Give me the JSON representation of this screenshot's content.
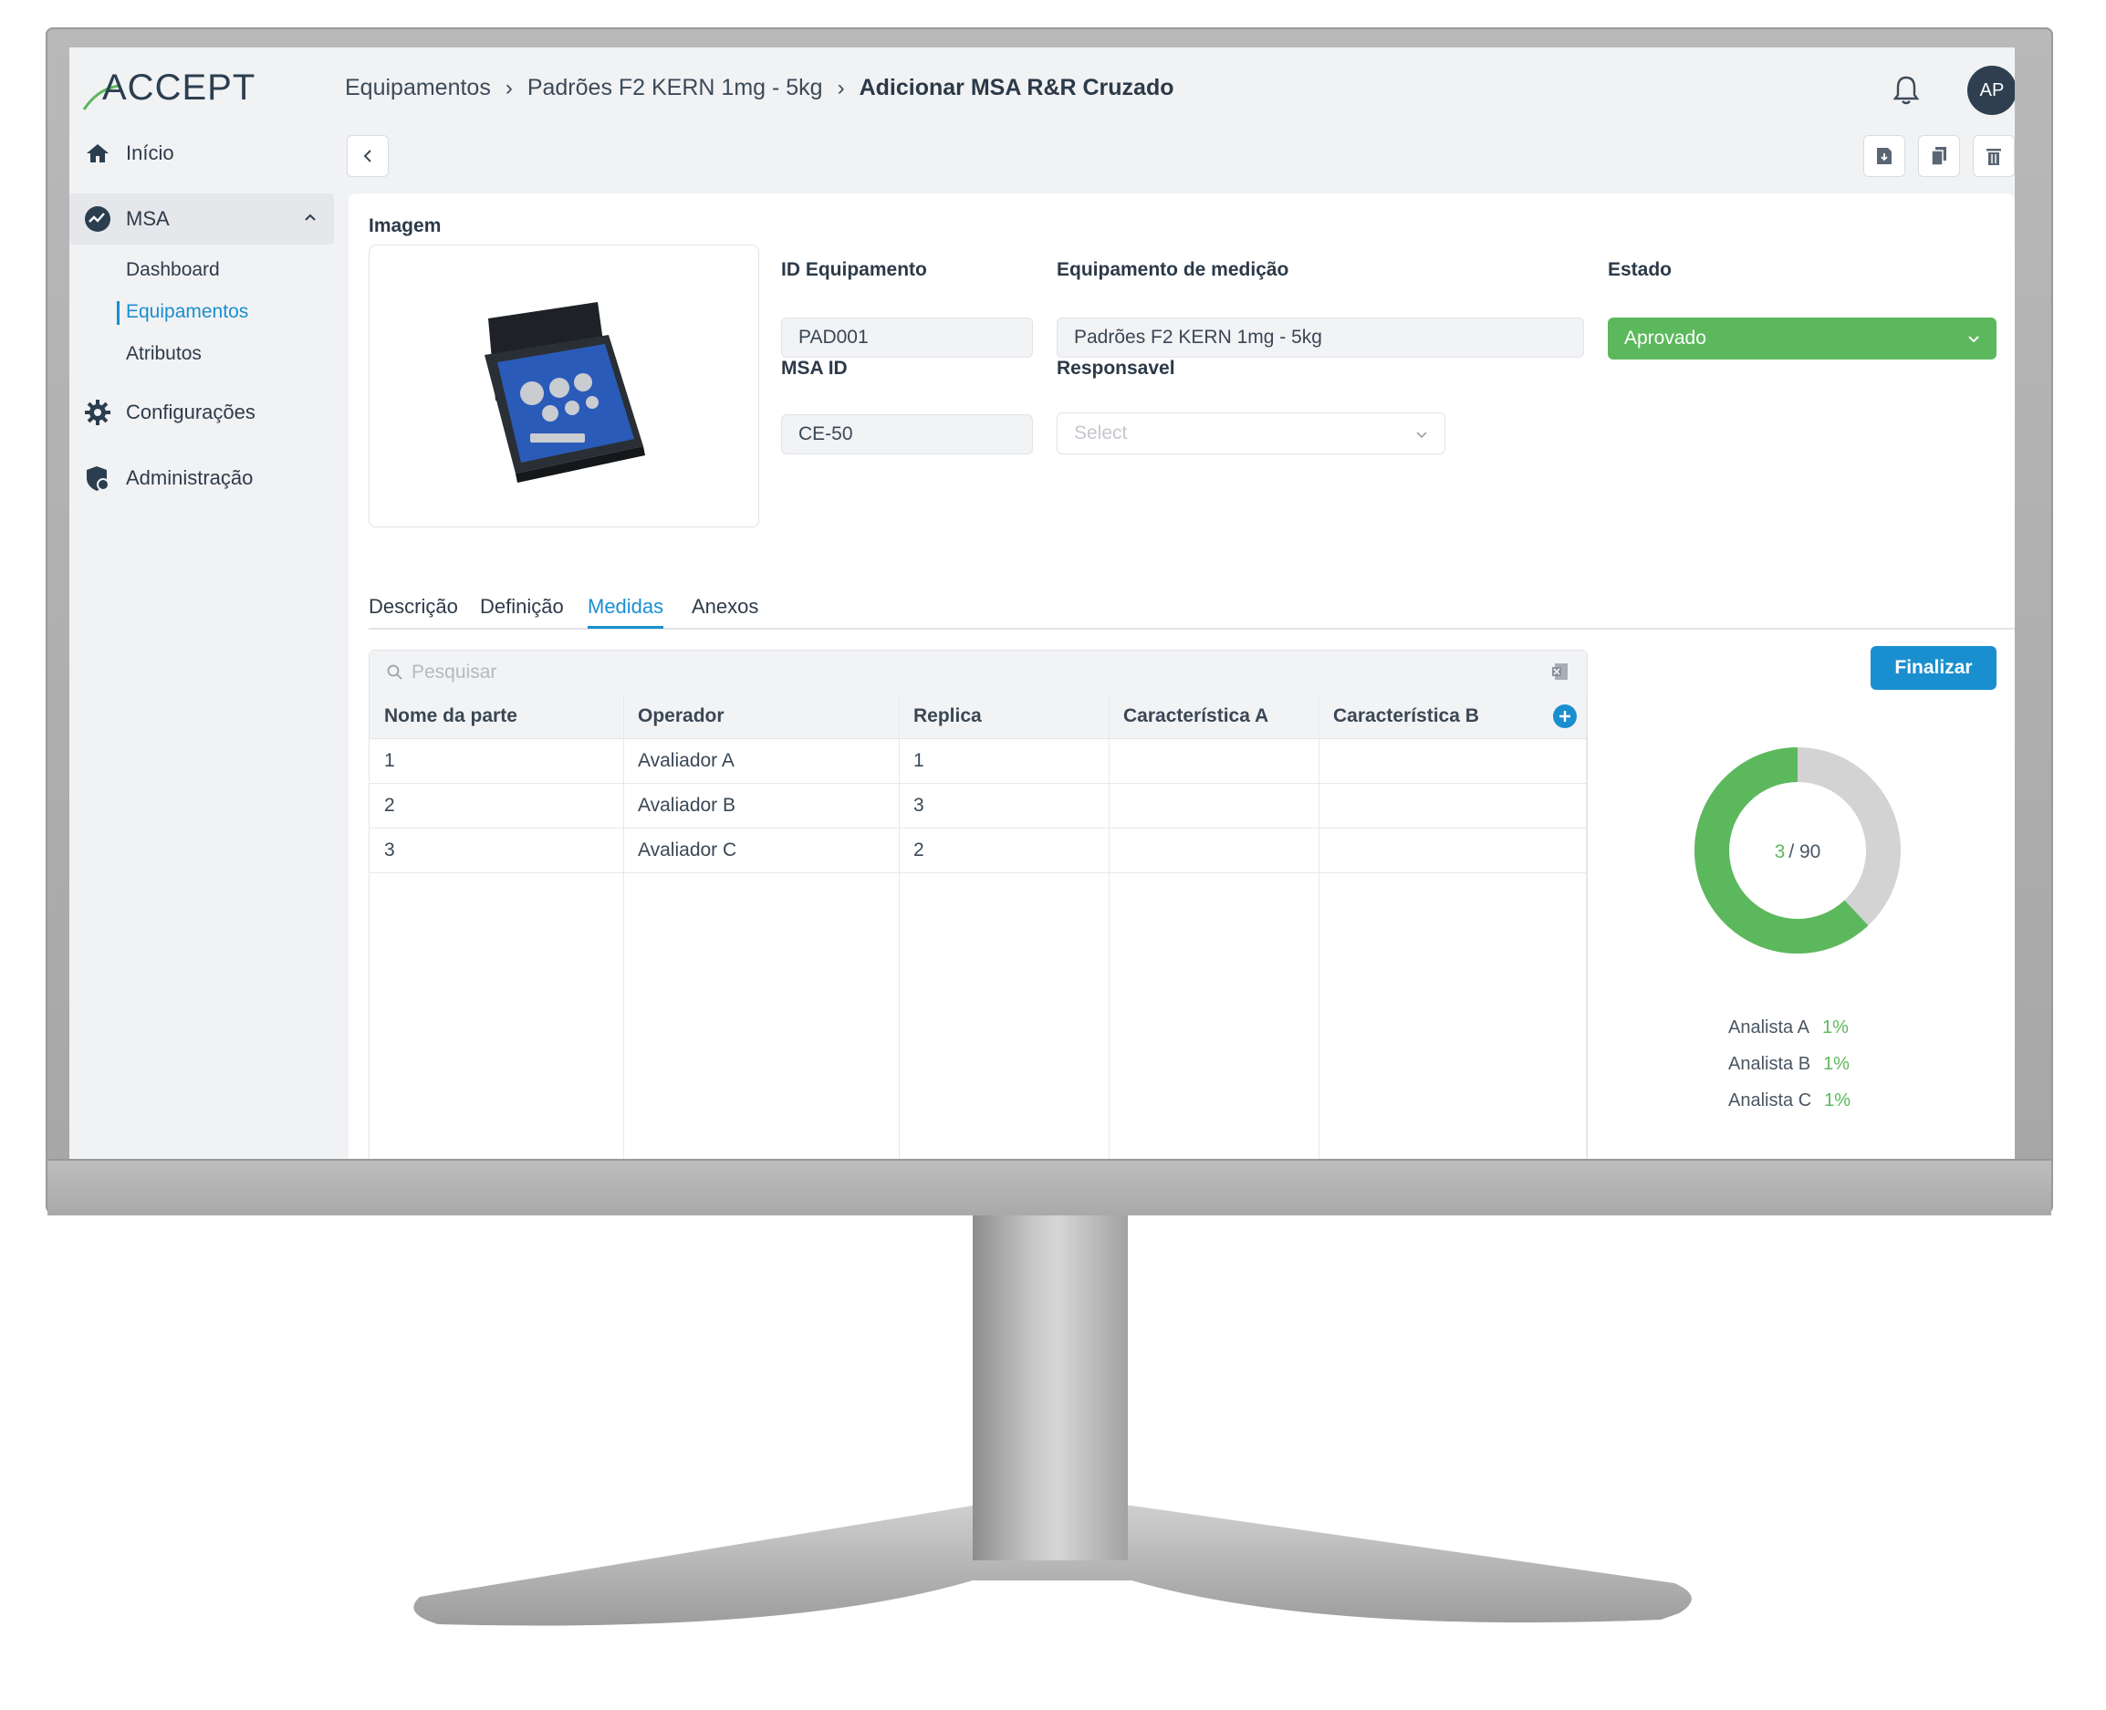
{
  "app": {
    "logo_text": "ACCEPT"
  },
  "sidebar": {
    "items": [
      {
        "label": "Início",
        "icon": "home-icon"
      },
      {
        "label": "MSA",
        "icon": "msa-icon"
      },
      {
        "label": "Configurações",
        "icon": "gear-icon"
      },
      {
        "label": "Administração",
        "icon": "shield-icon"
      }
    ],
    "msa_sub": [
      {
        "label": "Dashboard"
      },
      {
        "label": "Equipamentos",
        "active": true
      },
      {
        "label": "Atributos"
      }
    ]
  },
  "header": {
    "breadcrumb": [
      "Equipamentos",
      "Padrões F2 KERN 1mg - 5kg",
      "Adicionar MSA R&R Cruzado"
    ],
    "avatar": "AP"
  },
  "form": {
    "image_label": "Imagem",
    "id_equipamento_label": "ID Equipamento",
    "id_equipamento_value": "PAD001",
    "equipamento_label": "Equipamento de medição",
    "equipamento_value": "Padrões F2 KERN 1mg - 5kg",
    "estado_label": "Estado",
    "estado_value": "Aprovado",
    "msa_id_label": "MSA ID",
    "msa_id_value": "CE-50",
    "responsavel_label": "Responsavel",
    "responsavel_placeholder": "Select"
  },
  "tabs": [
    "Descrição",
    "Definição",
    "Medidas",
    "Anexos"
  ],
  "active_tab": "Medidas",
  "table": {
    "search_placeholder": "Pesquisar",
    "columns": [
      "Nome da parte",
      "Operador",
      "Replica",
      "Característica A",
      "Característica B"
    ],
    "rows": [
      [
        "1",
        "Avaliador A",
        "1",
        "",
        ""
      ],
      [
        "2",
        "Avaliador B",
        "3",
        "",
        ""
      ],
      [
        "3",
        "Avaliador C",
        "2",
        "",
        ""
      ]
    ]
  },
  "finalizar_label": "Finalizar",
  "progress": {
    "done": "3",
    "total": "/ 90",
    "done_fraction": 0.62,
    "colors": {
      "done": "#5cb85c",
      "remaining": "#d3d3d3"
    }
  },
  "analysts": [
    {
      "name": "Analista A",
      "pct": "1%"
    },
    {
      "name": "Analista B",
      "pct": "1%"
    },
    {
      "name": "Analista C",
      "pct": "1%"
    }
  ],
  "colors": {
    "accent": "#1a8fd0",
    "success": "#5cb85c",
    "sidebar_bg": "#f1f2f4"
  }
}
